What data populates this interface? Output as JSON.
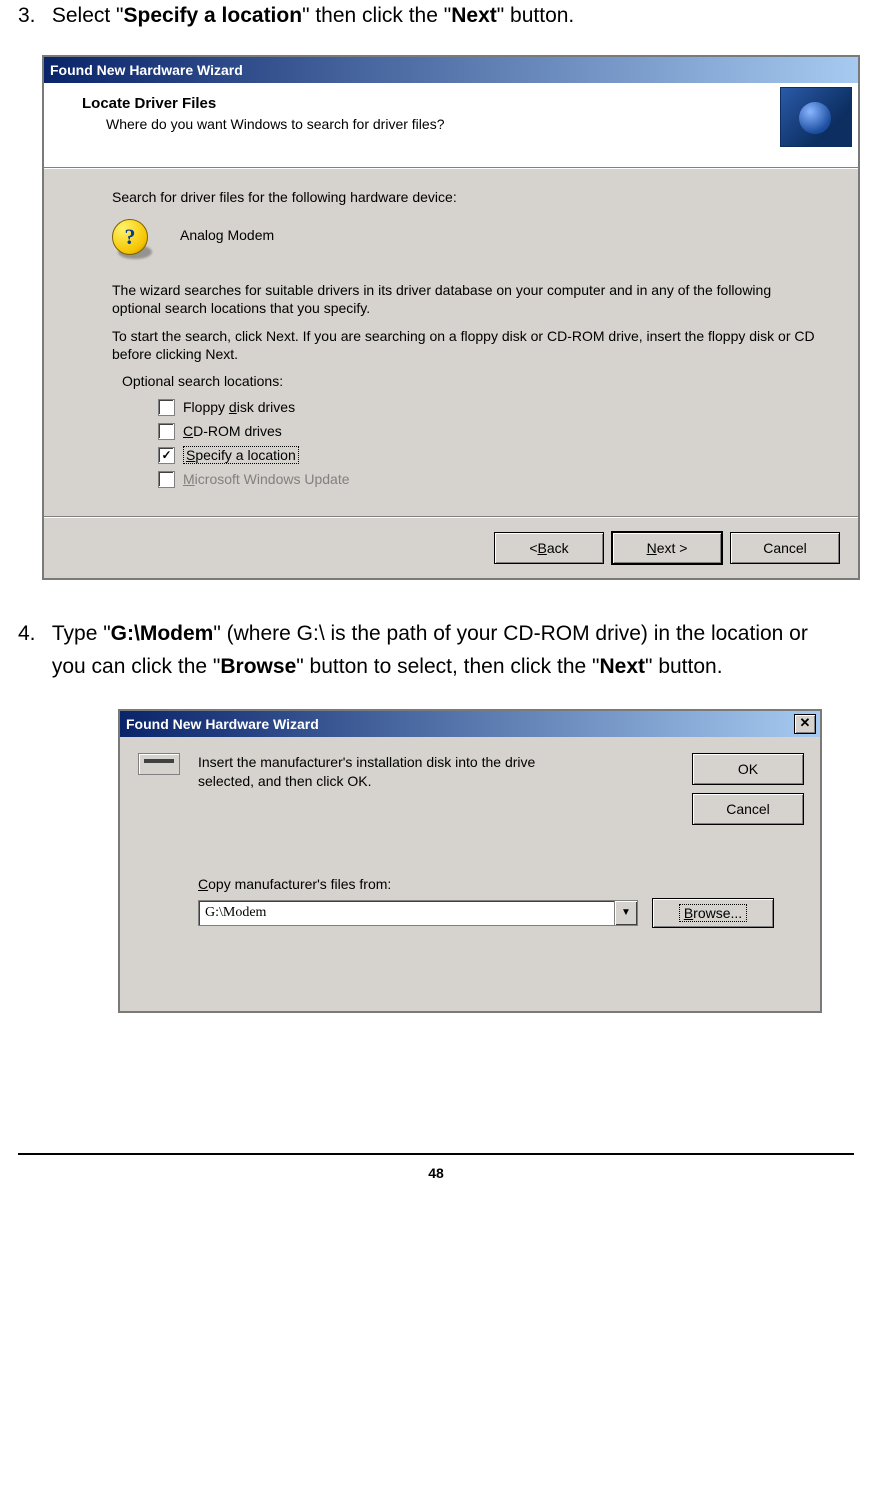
{
  "step3": {
    "num": "3.",
    "pre": "Select \"",
    "bold1": "Specify a location",
    "mid": "\" then click the \"",
    "bold2": "Next",
    "post": "\" button."
  },
  "wiz1": {
    "title": "Found New Hardware Wizard",
    "header_title": "Locate Driver Files",
    "header_sub": "Where do you want Windows to search for driver files?",
    "search_label": "Search for driver files for the following hardware device:",
    "device_name": "Analog Modem",
    "para1": "The wizard searches for suitable drivers in its driver database on your computer and in any of the following optional search locations that you specify.",
    "para2": "To start the search, click Next. If you are searching on a floppy disk or CD-ROM drive, insert the floppy disk or CD before clicking Next.",
    "opt_label": "Optional search locations:",
    "opts": [
      {
        "text": "Floppy disk drives",
        "ul": "d",
        "checked": false,
        "disabled": false,
        "focus": false
      },
      {
        "text": "CD-ROM drives",
        "ul": "C",
        "checked": false,
        "disabled": false,
        "focus": false
      },
      {
        "text": "Specify a location",
        "ul": "S",
        "checked": true,
        "disabled": false,
        "focus": true
      },
      {
        "text": "Microsoft Windows Update",
        "ul": "M",
        "checked": false,
        "disabled": true,
        "focus": false
      }
    ],
    "buttons": {
      "back": "< Back",
      "back_ul": "B",
      "next": "Next >",
      "next_ul": "N",
      "cancel": "Cancel"
    }
  },
  "step4": {
    "num": "4.",
    "pre": "Type \"",
    "bold1": "G:\\Modem",
    "mid1": "\" (where G:\\ is the path of your CD-ROM drive) in the location or you can click the \"",
    "bold2": "Browse",
    "mid2": "\" button to select, then click the \"",
    "bold3": "Next",
    "post": "\" button."
  },
  "wiz2": {
    "title": "Found New Hardware Wizard",
    "instruction": "Insert the manufacturer's installation disk into the drive selected, and then click OK.",
    "ok": "OK",
    "cancel": "Cancel",
    "copy_label_pre": "C",
    "copy_label": "opy manufacturer's files from:",
    "path_value": "G:\\Modem",
    "browse_pre": "B",
    "browse": "rowse..."
  },
  "page_number": "48"
}
